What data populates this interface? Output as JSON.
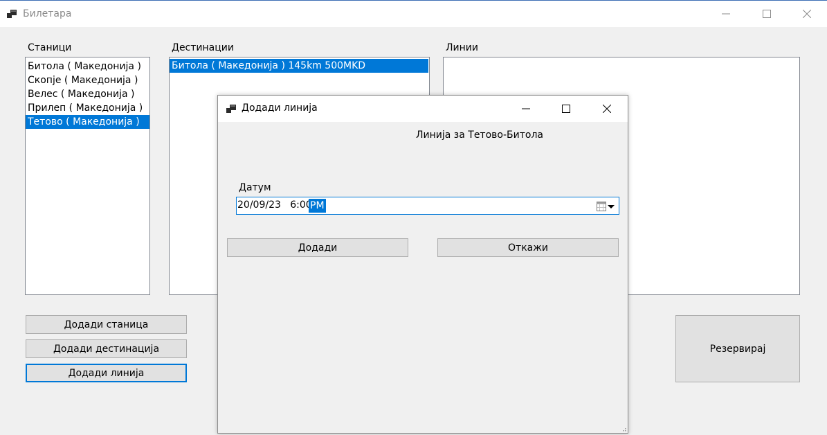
{
  "window": {
    "title": "Билетара",
    "icon": "app-window-icon",
    "controls": [
      "minimize-icon",
      "maximize-icon",
      "close-icon"
    ]
  },
  "stations": {
    "label": "Станици",
    "items": [
      "Битола ( Македонија )",
      "Скопје ( Македонија )",
      "Велес ( Македонија )",
      "Прилеп ( Македонија )",
      "Тетово ( Македонија )"
    ],
    "selected_index": 4
  },
  "destinations": {
    "label": "Дестинации",
    "items": [
      "Битола ( Македонија ) 145km 500MKD"
    ],
    "selected_index": 0
  },
  "lines": {
    "label": "Линии",
    "items": []
  },
  "buttons": {
    "add_station": "Додади станица",
    "add_destination": "Додади дестинација",
    "add_line": "Додади линија",
    "reserve": "Резервирај"
  },
  "dialog": {
    "title": "Додади линија",
    "heading": "Линија за Тетово-Битола",
    "date_label": "Датум",
    "date_value": "20/09/23   6:00",
    "ampm": "PM",
    "add_button": "Додади",
    "cancel_button": "Откажи"
  },
  "colors": {
    "selection": "#0078d7",
    "background": "#f0f0f0",
    "button": "#e1e1e1"
  }
}
